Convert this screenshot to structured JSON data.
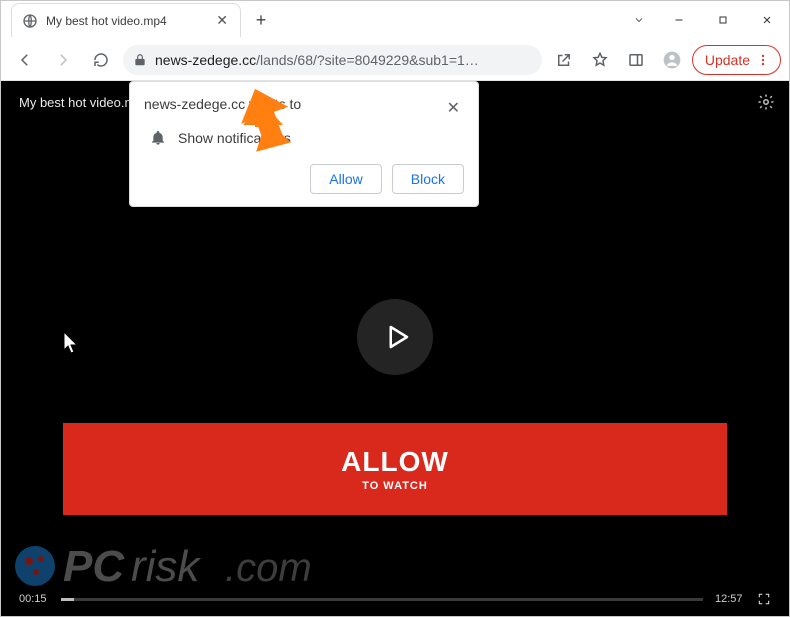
{
  "window": {
    "tab_title": "My best hot video.mp4"
  },
  "toolbar": {
    "url_host": "news-zedege.cc",
    "url_path": "/lands/68/?site=8049229&sub1=1…",
    "update_label": "Update"
  },
  "notification": {
    "message": "news-zedege.cc wants to",
    "line": "Show notifications",
    "allow": "Allow",
    "block": "Block"
  },
  "page": {
    "video_title": "My best hot video.mp4",
    "allow_main": "ALLOW",
    "allow_sub": "TO WATCH",
    "time_current": "00:15",
    "time_total": "12:57"
  },
  "watermark": {
    "text": "PCrisk.com"
  }
}
